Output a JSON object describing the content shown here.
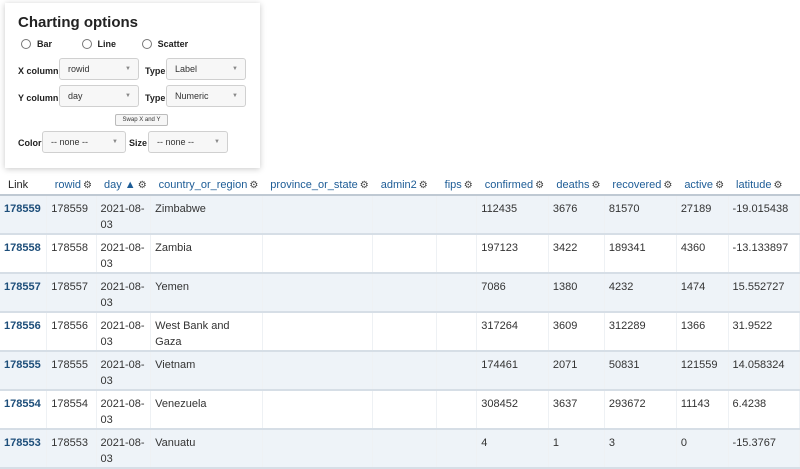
{
  "chart_options": {
    "title": "Charting options",
    "chart_types": [
      "Bar",
      "Line",
      "Scatter"
    ],
    "x_column_label": "X column",
    "x_column_value": "rowid",
    "x_type_label": "Type",
    "x_type_value": "Label",
    "y_column_label": "Y column",
    "y_column_value": "day",
    "y_type_label": "Type",
    "y_type_value": "Numeric",
    "swap_label": "Swap X and Y",
    "color_label": "Color",
    "color_value": "-- none --",
    "size_label": "Size",
    "size_value": "-- none --"
  },
  "table": {
    "columns": [
      "Link",
      "rowid",
      "day ▲",
      "country_or_region",
      "province_or_state",
      "admin2",
      "fips",
      "confirmed",
      "deaths",
      "recovered",
      "active",
      "latitude"
    ],
    "rows": [
      {
        "link": "178559",
        "rowid": "178559",
        "day": "2021-08-03",
        "country": "Zimbabwe",
        "province": "",
        "admin2": "",
        "fips": "",
        "confirmed": "112435",
        "deaths": "3676",
        "recovered": "81570",
        "active": "27189",
        "latitude": "-19.015438"
      },
      {
        "link": "178558",
        "rowid": "178558",
        "day": "2021-08-03",
        "country": "Zambia",
        "province": "",
        "admin2": "",
        "fips": "",
        "confirmed": "197123",
        "deaths": "3422",
        "recovered": "189341",
        "active": "4360",
        "latitude": "-13.133897"
      },
      {
        "link": "178557",
        "rowid": "178557",
        "day": "2021-08-03",
        "country": "Yemen",
        "province": "",
        "admin2": "",
        "fips": "",
        "confirmed": "7086",
        "deaths": "1380",
        "recovered": "4232",
        "active": "1474",
        "latitude": "15.552727"
      },
      {
        "link": "178556",
        "rowid": "178556",
        "day": "2021-08-03",
        "country": "West Bank and Gaza",
        "province": "",
        "admin2": "",
        "fips": "",
        "confirmed": "317264",
        "deaths": "3609",
        "recovered": "312289",
        "active": "1366",
        "latitude": "31.9522"
      },
      {
        "link": "178555",
        "rowid": "178555",
        "day": "2021-08-03",
        "country": "Vietnam",
        "province": "",
        "admin2": "",
        "fips": "",
        "confirmed": "174461",
        "deaths": "2071",
        "recovered": "50831",
        "active": "121559",
        "latitude": "14.058324"
      },
      {
        "link": "178554",
        "rowid": "178554",
        "day": "2021-08-03",
        "country": "Venezuela",
        "province": "",
        "admin2": "",
        "fips": "",
        "confirmed": "308452",
        "deaths": "3637",
        "recovered": "293672",
        "active": "11143",
        "latitude": "6.4238"
      },
      {
        "link": "178553",
        "rowid": "178553",
        "day": "2021-08-03",
        "country": "Vanuatu",
        "province": "",
        "admin2": "",
        "fips": "",
        "confirmed": "4",
        "deaths": "1",
        "recovered": "3",
        "active": "0",
        "latitude": "-15.3767"
      }
    ]
  }
}
